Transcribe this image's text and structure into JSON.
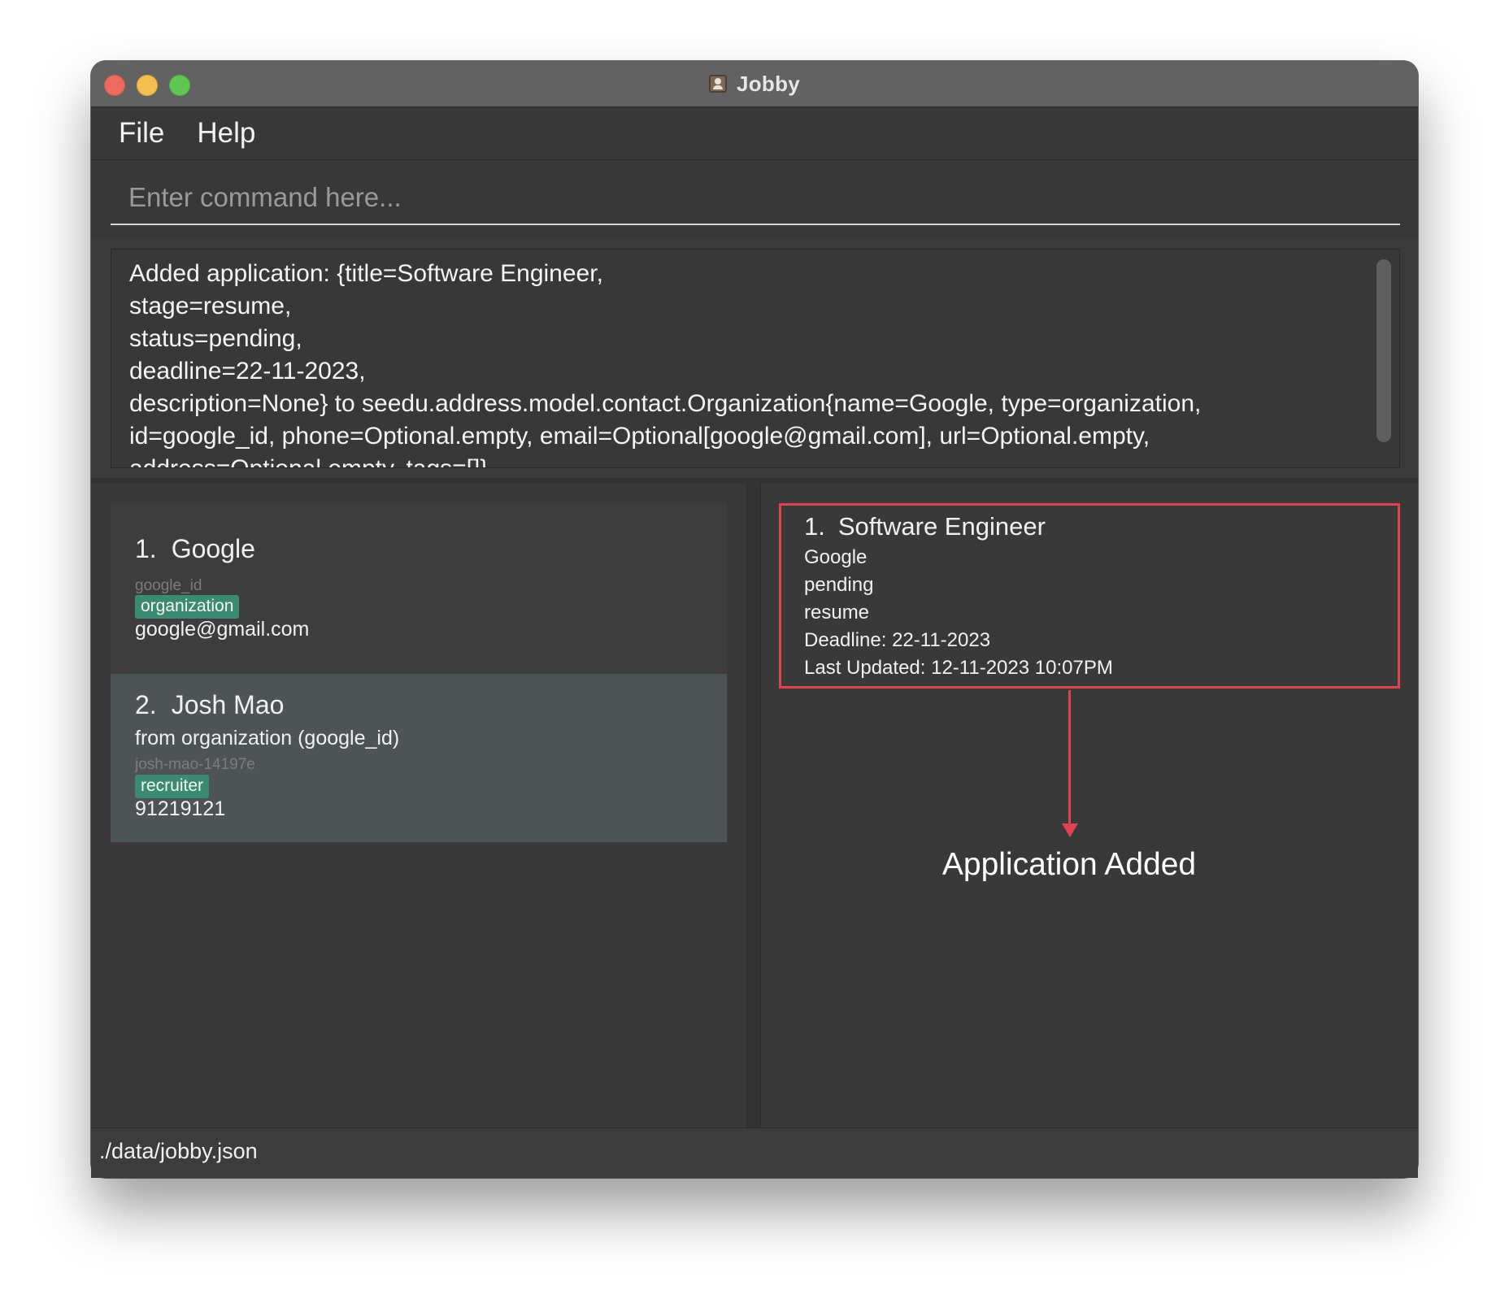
{
  "window": {
    "title": "Jobby",
    "app_icon": "contact-card-icon"
  },
  "menu": {
    "items": [
      "File",
      "Help"
    ]
  },
  "command": {
    "placeholder": "Enter command here...",
    "value": ""
  },
  "result": {
    "text": "Added application: {title=Software Engineer,\nstage=resume,\nstatus=pending,\ndeadline=22-11-2023,\ndescription=None} to seedu.address.model.contact.Organization{name=Google, type=organization,\nid=google_id, phone=Optional.empty, email=Optional[google@gmail.com], url=Optional.empty,\naddress=Optional.empty, tags=[]}"
  },
  "contacts": [
    {
      "index": "1.",
      "name": "Google",
      "id": "google_id",
      "tag": "organization",
      "detail": "google@gmail.com"
    },
    {
      "index": "2.",
      "name": "Josh Mao",
      "from": "from organization (google_id)",
      "id": "josh-mao-14197e",
      "tag": "recruiter",
      "detail": "91219121"
    }
  ],
  "applications": [
    {
      "index": "1.",
      "title": "Software Engineer",
      "company": "Google",
      "status": "pending",
      "stage": "resume",
      "deadline": "Deadline: 22-11-2023",
      "last_updated": "Last Updated: 12-11-2023 10:07PM"
    }
  ],
  "annotation": {
    "label": "Application Added"
  },
  "status_bar": {
    "path": "./data/jobby.json"
  },
  "colors": {
    "highlight": "#e04350",
    "tag": "#3b8a72",
    "selected_row": "#4e5356"
  }
}
